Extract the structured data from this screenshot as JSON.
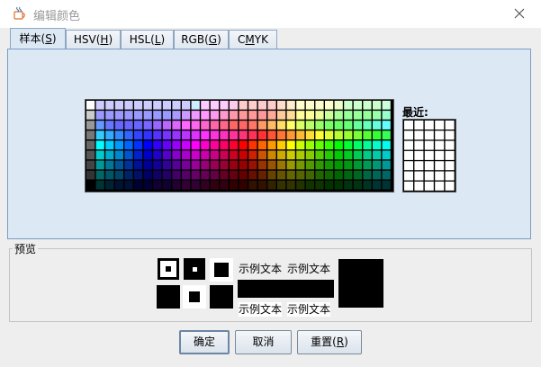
{
  "window": {
    "title": "编辑颜色",
    "app_icon": "java-cup-icon",
    "close_icon": "close-icon"
  },
  "tabs": [
    {
      "pre": "样本(",
      "mn": "S",
      "post": ")",
      "selected": true
    },
    {
      "pre": "HSV(",
      "mn": "H",
      "post": ")",
      "selected": false
    },
    {
      "pre": "HSL(",
      "mn": "L",
      "post": ")",
      "selected": false
    },
    {
      "pre": "RGB(",
      "mn": "G",
      "post": ")",
      "selected": false
    },
    {
      "pre": "C",
      "mn": "M",
      "post": "YK",
      "selected": false
    }
  ],
  "swatches": {
    "rows": [
      [
        "#ffffff",
        "#ccccff",
        "#ccccff",
        "#ccccff",
        "#ccccff",
        "#ccccff",
        "#ccccff",
        "#ccccff",
        "#ccccff",
        "#ccccff",
        "#ccccff",
        "#cceeff",
        "#ffccff",
        "#ffccff",
        "#ffccff",
        "#ffccee",
        "#ffcccc",
        "#ffcccc",
        "#ffcccc",
        "#ffcccc",
        "#ffdccc",
        "#ffeecc",
        "#ffffcc",
        "#ffffcc",
        "#ffffcc",
        "#ffffcc",
        "#eeffcc",
        "#ccffcc",
        "#ccffcc",
        "#ccffcc",
        "#ccffcc",
        "#ccffdd"
      ],
      [
        "#cccccc",
        "#9999ff",
        "#9999ff",
        "#9999ff",
        "#9999ff",
        "#9999ff",
        "#9999ff",
        "#9999ff",
        "#9999ff",
        "#aa99ff",
        "#cc99ff",
        "#ee99ff",
        "#ff99ff",
        "#ff99ee",
        "#ff99cc",
        "#ff99aa",
        "#ff9999",
        "#ff9999",
        "#ff9999",
        "#ffaa99",
        "#ffcc99",
        "#ffdd99",
        "#ffff99",
        "#ffff99",
        "#eeff99",
        "#ccff99",
        "#aaff99",
        "#99ff99",
        "#99ff99",
        "#99ff99",
        "#99ffaa",
        "#99ffcc"
      ],
      [
        "#999999",
        "#6699ff",
        "#6677ff",
        "#6666ff",
        "#6666ff",
        "#6666ff",
        "#7766ff",
        "#9966ff",
        "#bb66ff",
        "#dd66ff",
        "#ff66ff",
        "#ff66ee",
        "#ff66cc",
        "#ff66aa",
        "#ff6688",
        "#ff6666",
        "#ff6666",
        "#ff7766",
        "#ff9966",
        "#ffbb66",
        "#ffdd66",
        "#ffff66",
        "#ddff66",
        "#bbff66",
        "#99ff66",
        "#77ff66",
        "#66ff66",
        "#66ff77",
        "#66ff99",
        "#66ffbb",
        "#66ffdd",
        "#66ffff"
      ],
      [
        "#777777",
        "#33ccff",
        "#33aaff",
        "#3388ff",
        "#3366ff",
        "#3344ff",
        "#3333ff",
        "#5533ff",
        "#7733ff",
        "#9933ff",
        "#bb33ff",
        "#dd33ff",
        "#ff33ff",
        "#ff33dd",
        "#ff33bb",
        "#ff3399",
        "#ff3377",
        "#ff3355",
        "#ff3333",
        "#ff5533",
        "#ff7733",
        "#ff9933",
        "#ffbb33",
        "#ffdd33",
        "#ffff33",
        "#ddff33",
        "#bbff33",
        "#99ff33",
        "#77ff33",
        "#55ff33",
        "#33ff33",
        "#33ff55"
      ],
      [
        "#666666",
        "#00ffff",
        "#00ccff",
        "#0099ff",
        "#0066ff",
        "#0033ff",
        "#0000ff",
        "#3300ff",
        "#6600ff",
        "#9900ff",
        "#cc00ff",
        "#ff00ff",
        "#ff00cc",
        "#ff0099",
        "#ff0066",
        "#ff0033",
        "#ff0000",
        "#ff3300",
        "#ff6600",
        "#ff9900",
        "#ffcc00",
        "#ffff00",
        "#ccff00",
        "#99ff00",
        "#66ff00",
        "#33ff00",
        "#00ff00",
        "#00ff33",
        "#00ff66",
        "#00ff99",
        "#00ffcc",
        "#00ffee"
      ],
      [
        "#555555",
        "#00cccc",
        "#00aacc",
        "#0088cc",
        "#0055cc",
        "#0022cc",
        "#0000cc",
        "#2200cc",
        "#5500cc",
        "#8800cc",
        "#aa00cc",
        "#cc00cc",
        "#cc00aa",
        "#cc0088",
        "#cc0055",
        "#cc0022",
        "#cc0000",
        "#cc2200",
        "#cc5500",
        "#cc8800",
        "#ccaa00",
        "#cccc00",
        "#aacc00",
        "#88cc00",
        "#55cc00",
        "#22cc00",
        "#00cc00",
        "#00cc22",
        "#00cc55",
        "#00cc88",
        "#00ccaa",
        "#00cccc"
      ],
      [
        "#444444",
        "#009999",
        "#007799",
        "#005599",
        "#003399",
        "#001199",
        "#000099",
        "#110099",
        "#330099",
        "#550099",
        "#770099",
        "#990099",
        "#990077",
        "#990055",
        "#990033",
        "#990011",
        "#990000",
        "#991100",
        "#993300",
        "#995500",
        "#997700",
        "#999900",
        "#779900",
        "#559900",
        "#339900",
        "#119900",
        "#009900",
        "#009911",
        "#009933",
        "#009955",
        "#009977",
        "#009999"
      ],
      [
        "#333333",
        "#006666",
        "#005566",
        "#004466",
        "#002266",
        "#001166",
        "#000066",
        "#110066",
        "#220066",
        "#440066",
        "#550066",
        "#660066",
        "#660055",
        "#660044",
        "#660022",
        "#660011",
        "#660000",
        "#661100",
        "#662200",
        "#664400",
        "#665500",
        "#666600",
        "#556600",
        "#446600",
        "#226600",
        "#116600",
        "#006600",
        "#006611",
        "#006622",
        "#006644",
        "#006655",
        "#006666"
      ],
      [
        "#000000",
        "#003333",
        "#002233",
        "#001133",
        "#001133",
        "#000033",
        "#000033",
        "#110033",
        "#110033",
        "#220033",
        "#330033",
        "#330033",
        "#330022",
        "#330011",
        "#330011",
        "#330000",
        "#330000",
        "#331100",
        "#331100",
        "#332200",
        "#333300",
        "#333300",
        "#223300",
        "#113300",
        "#113300",
        "#003300",
        "#003300",
        "#003311",
        "#003311",
        "#003322",
        "#003333",
        "#003333"
      ]
    ]
  },
  "recent": {
    "label": "最近:",
    "rows": 7,
    "cols": 5,
    "color": "#ffffff"
  },
  "preview": {
    "legend": "预览",
    "sample_text": "示例文本",
    "fg_color": "#000000",
    "bg_color": "#ffffff"
  },
  "buttons": {
    "ok": {
      "label": "确定"
    },
    "cancel": {
      "label": "取消"
    },
    "reset": {
      "pre": "重置(",
      "mn": "R",
      "post": ")"
    }
  }
}
